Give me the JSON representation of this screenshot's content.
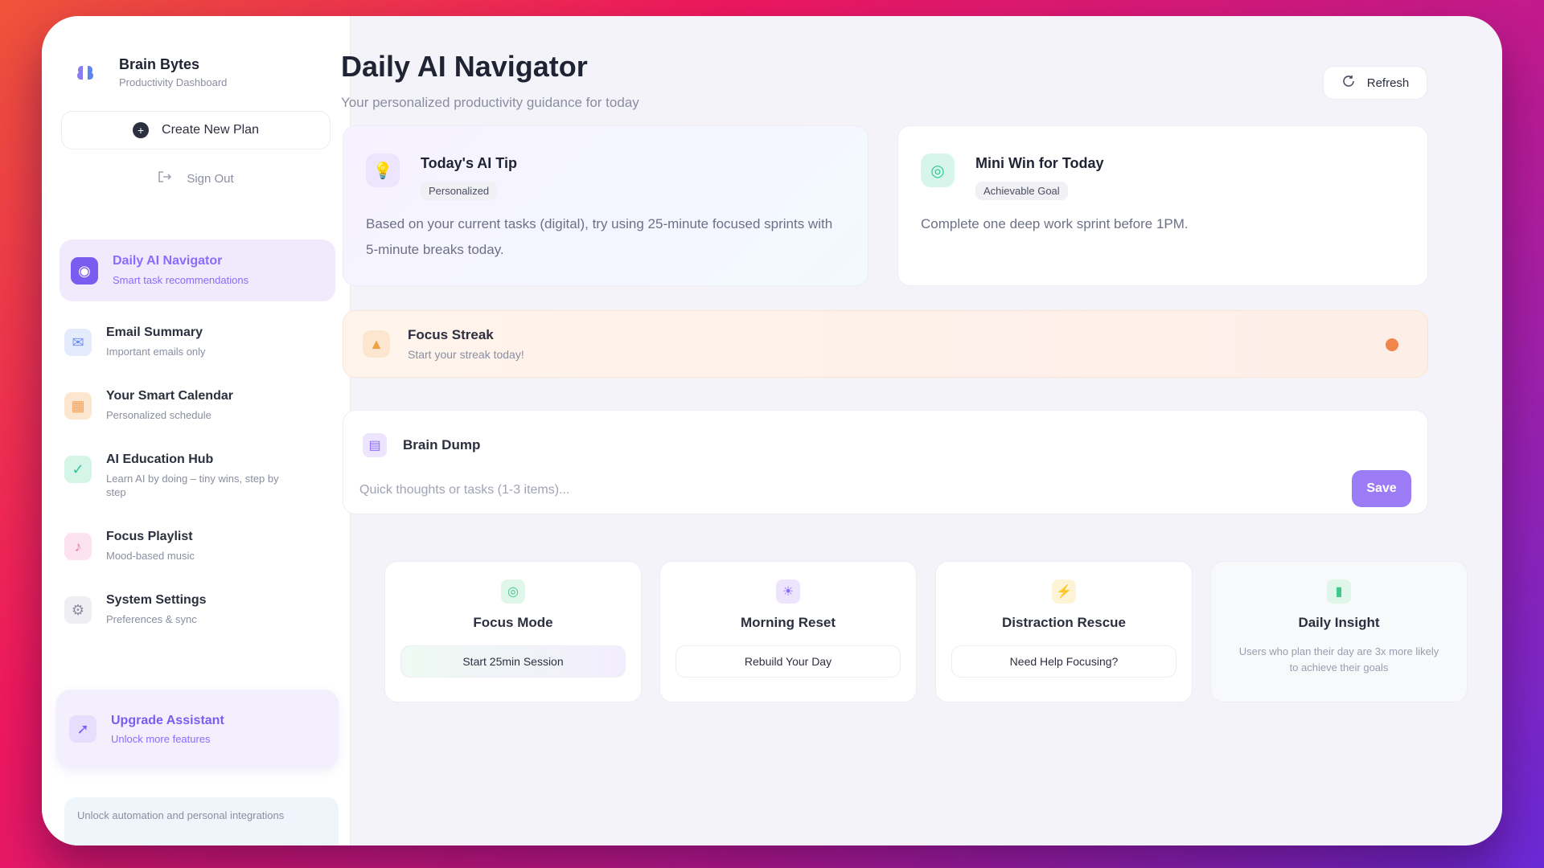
{
  "brand": {
    "name": "Brain Bytes",
    "subtitle": "Productivity Dashboard",
    "icon": "brain-icon"
  },
  "sidebar": {
    "create_label": "Create New Plan",
    "signout_label": "Sign Out",
    "items": [
      {
        "title": "Daily AI Navigator",
        "subtitle": "Smart task recommendations",
        "icon": "compass-icon",
        "color": "#7b5cf0",
        "active": true
      },
      {
        "title": "Email Summary",
        "subtitle": "Important emails only",
        "icon": "mail-icon",
        "color": "#6a8df5",
        "active": false
      },
      {
        "title": "Your Smart Calendar",
        "subtitle": "Personalized schedule",
        "icon": "calendar-icon",
        "color": "#f5a25c",
        "active": false
      },
      {
        "title": "AI Education Hub",
        "subtitle": "Learn AI by doing – tiny wins, step by step",
        "icon": "book-icon",
        "color": "#2cc89a",
        "active": false
      },
      {
        "title": "Focus Playlist",
        "subtitle": "Mood-based music",
        "icon": "music-icon",
        "color": "#f07aa5",
        "active": false
      },
      {
        "title": "System Settings",
        "subtitle": "Preferences & sync",
        "icon": "gear-icon",
        "color": "#8a8ea0",
        "active": false
      }
    ],
    "upgrade": {
      "title": "Upgrade Assistant",
      "subtitle": "Unlock more features",
      "icon": "rocket-icon"
    },
    "footer_note": "Unlock automation and personal integrations"
  },
  "header": {
    "title": "Daily AI Navigator",
    "subtitle": "Your personalized productivity guidance for today",
    "refresh_label": "Refresh"
  },
  "tip_card": {
    "title": "Today's AI Tip",
    "badge": "Personalized",
    "body": "Based on your current tasks (digital), try using 25-minute focused sprints with 5-minute breaks today."
  },
  "win_card": {
    "title": "Mini Win for Today",
    "badge": "Achievable Goal",
    "body": "Complete one deep work sprint before 1PM."
  },
  "streak": {
    "title": "Focus Streak",
    "subtitle": "Start your streak today!"
  },
  "brain_dump": {
    "title": "Brain Dump",
    "placeholder": "Quick thoughts or tasks (1-3 items)...",
    "save_label": "Save"
  },
  "mini_cards": [
    {
      "title": "Focus Mode",
      "button": "Start 25min Session",
      "icon": "target-icon",
      "color": "#3ec98a"
    },
    {
      "title": "Morning Reset",
      "button": "Rebuild Your Day",
      "icon": "sunrise-icon",
      "color": "#8b6bff"
    },
    {
      "title": "Distraction Rescue",
      "button": "Need Help Focusing?",
      "icon": "lightning-icon",
      "color": "#f5c24a"
    },
    {
      "title": "Daily Insight",
      "description": "Users who plan their day are 3x more likely to achieve their goals",
      "icon": "chart-icon",
      "color": "#3ec98a"
    }
  ],
  "colors": {
    "accent": "#8b6bff",
    "streak_dot": "#f1864c"
  }
}
